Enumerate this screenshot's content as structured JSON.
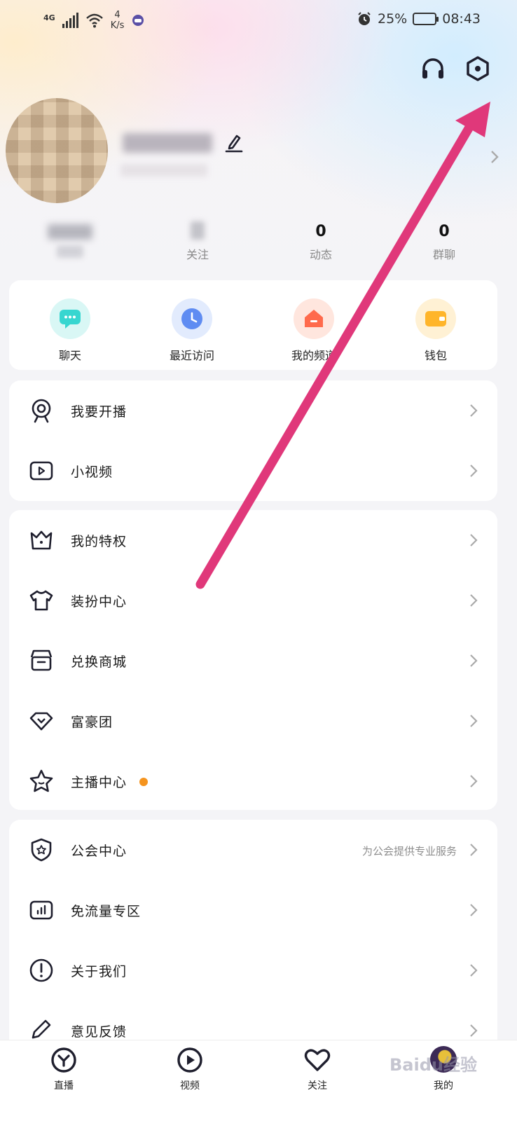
{
  "status_bar": {
    "network": "4G",
    "net_speed_value": "4",
    "net_speed_unit": "K/s",
    "battery": "25%",
    "time": "08:43"
  },
  "profile": {
    "stats": [
      {
        "value": "",
        "label": ""
      },
      {
        "value": "",
        "label": "关注"
      },
      {
        "value": "0",
        "label": "动态"
      },
      {
        "value": "0",
        "label": "群聊"
      }
    ]
  },
  "quick_actions": [
    {
      "label": "聊天",
      "icon": "chat-bubble-icon",
      "color": "#37d6d0"
    },
    {
      "label": "最近访问",
      "icon": "clock-icon",
      "color": "#5f8cf2"
    },
    {
      "label": "我的频道",
      "icon": "house-icon",
      "color": "#ff6a4c"
    },
    {
      "label": "钱包",
      "icon": "wallet-icon",
      "color": "#ffb52a"
    }
  ],
  "menu_group_1": [
    {
      "label": "我要开播",
      "icon": "webcam-icon"
    },
    {
      "label": "小视频",
      "icon": "video-play-icon"
    }
  ],
  "menu_group_2": [
    {
      "label": "我的特权",
      "icon": "crown-icon"
    },
    {
      "label": "装扮中心",
      "icon": "shirt-icon"
    },
    {
      "label": "兑换商城",
      "icon": "store-icon"
    },
    {
      "label": "富豪团",
      "icon": "diamond-icon"
    },
    {
      "label": "主播中心",
      "icon": "star-icon",
      "has_dot": true
    }
  ],
  "menu_group_3": [
    {
      "label": "公会中心",
      "icon": "shield-icon",
      "subtitle": "为公会提供专业服务"
    },
    {
      "label": "免流量专区",
      "icon": "chart-icon"
    },
    {
      "label": "关于我们",
      "icon": "info-icon"
    },
    {
      "label": "意见反馈",
      "icon": "pen-icon"
    }
  ],
  "tab_bar": [
    {
      "label": "直播",
      "icon": "live-icon"
    },
    {
      "label": "视频",
      "icon": "video-tab-icon"
    },
    {
      "label": "关注",
      "icon": "heart-icon"
    },
    {
      "label": "我的",
      "icon": "avatar-icon"
    }
  ],
  "watermark": "Baidu经验",
  "colors": {
    "annotation_arrow": "#e0387a",
    "accent_dot": "#f5941e"
  }
}
